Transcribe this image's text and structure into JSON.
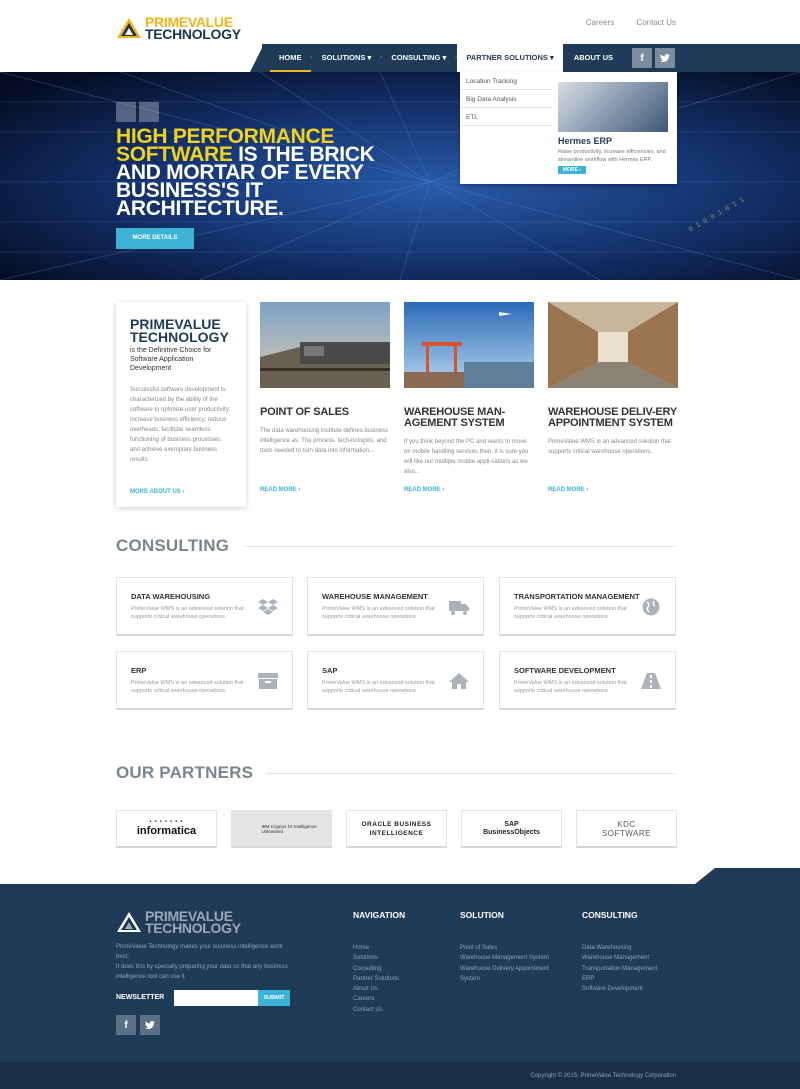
{
  "header": {
    "logo_line1": "PRIMEVALUE",
    "logo_line2": "TECHNOLOGY",
    "top_links": [
      "Careers",
      "Contact Us"
    ]
  },
  "nav": {
    "items": [
      "HOME",
      "SOLUTIONS",
      "CONSULTING",
      "PARTNER SOLUTIONS",
      "ABOUT US"
    ],
    "social": [
      "f",
      "t"
    ]
  },
  "dropdown": {
    "items": [
      "Location Tracking",
      "Big Data Analysis",
      "ETL"
    ],
    "feature_title": "Hermes ERP",
    "feature_desc": "Raise productivity, increase efficiencies, and streamline workflow with Hermes ERP.",
    "feature_more": "MORE"
  },
  "hero": {
    "line1": "HIGH PERFORMANCE",
    "line2a": "SOFTWARE",
    "line2b": " IS THE BRICK",
    "line3": "AND MORTAR OF EVERY",
    "line4": "BUSINESS'S IT",
    "line5": "ARCHITECTURE.",
    "button": "MORE DETAILS"
  },
  "intro": {
    "title1": "PRIMEVALUE",
    "title2": "TECHNOLOGY",
    "subtitle": "is the Definitive Choice for Software Application Development",
    "body": "Successful software development is characterized by the ability of the software to optimize user productivity: increase business efficiency; reduce overheads; facilitate seamless functioning of business processes; and achieve exemplary business results.",
    "link": "MORE ABOUT US"
  },
  "cards": [
    {
      "title": "POINT OF SALES",
      "body": "The data warehousing institute defines business intelligence as: The process, tech-nologies, and tools needed to turn data into information...",
      "link": "READ MORE"
    },
    {
      "title": "WAREHOUSE MAN-AGEMENT SYSTEM",
      "body": "If you think beyond the PC and wants to move on mobile handling services then, it is sure you will like our multiple mobile appli-cations as we also...",
      "link": "READ MORE"
    },
    {
      "title": "WAREHOUSE DELIV-ERY APPOINTMENT SYSTEM",
      "body": "PrimeValue WMS is an advanced solution that supports critical warehouse operations.",
      "link": "READ MORE"
    }
  ],
  "consulting": {
    "heading": "CONSULTING",
    "items": [
      {
        "title": "DATA WAREHOUSING",
        "desc": "PrimeValue WMS is an advanced solution that supports critical warehouse operations.",
        "icon": "dropbox-icon"
      },
      {
        "title": "WAREHOUSE MANAGEMENT",
        "desc": "PrimeValue WMS is an advanced solution that supports critical warehouse operations.",
        "icon": "truck-icon"
      },
      {
        "title": "TRANSPORTATION MANAGEMENT",
        "desc": "PrimeValue WMS is an advanced solution that supports critical warehouse operations.",
        "icon": "globe-icon"
      },
      {
        "title": "ERP",
        "desc": "PrimeValue WMS is an advanced solution that supports critical warehouse operations.",
        "icon": "archive-icon"
      },
      {
        "title": "SAP",
        "desc": "PrimeValue WMS is an advanced solution that supports critical warehouse operations.",
        "icon": "home-icon"
      },
      {
        "title": "SOFTWARE DEVELOPMENT",
        "desc": "PrimeValue WMS is an advanced solution that supports critical warehouse operations.",
        "icon": "road-icon"
      }
    ]
  },
  "partners": {
    "heading": "OUR PARTNERS",
    "logos": [
      "informatica",
      "IBM Cognos 10 Intelligence Unleashed",
      "ORACLE BUSINESS INTELLIGENCE",
      "SAP BusinessObjects",
      "KDC SOFTWARE"
    ]
  },
  "footer": {
    "logo_line1": "PRIMEVALUE",
    "logo_line2": "TECHNOLOGY",
    "desc1": "PrimeValue Technology makes your business intelligence work best.",
    "desc2": "It does this by specially preparing your data so that any business intelligence tool can use it.",
    "newsletter_label": "NEWSLETTER",
    "submit": "SUBMIT",
    "columns": [
      {
        "heading": "NAVIGATION",
        "links": [
          "Home",
          "Solutions",
          "Consulting",
          "Partner Solutions",
          "About Us",
          "Careers",
          "Contact Us"
        ]
      },
      {
        "heading": "SOLUTION",
        "links": [
          "Point of Sales",
          "Warehouse Management System",
          "Warehouse Delivery Appointment",
          "System"
        ]
      },
      {
        "heading": "CONSULTING",
        "links": [
          "Data Warehousing",
          "Warehouse Management",
          "Transportation Management",
          "ERP",
          "Software Development"
        ]
      }
    ],
    "copyright": "Copyright © 2015, PrimeValue Technology Corporation"
  },
  "colors": {
    "navy": "#1f3b57",
    "accent": "#3bb3d6",
    "gold": "#f1b51c"
  }
}
